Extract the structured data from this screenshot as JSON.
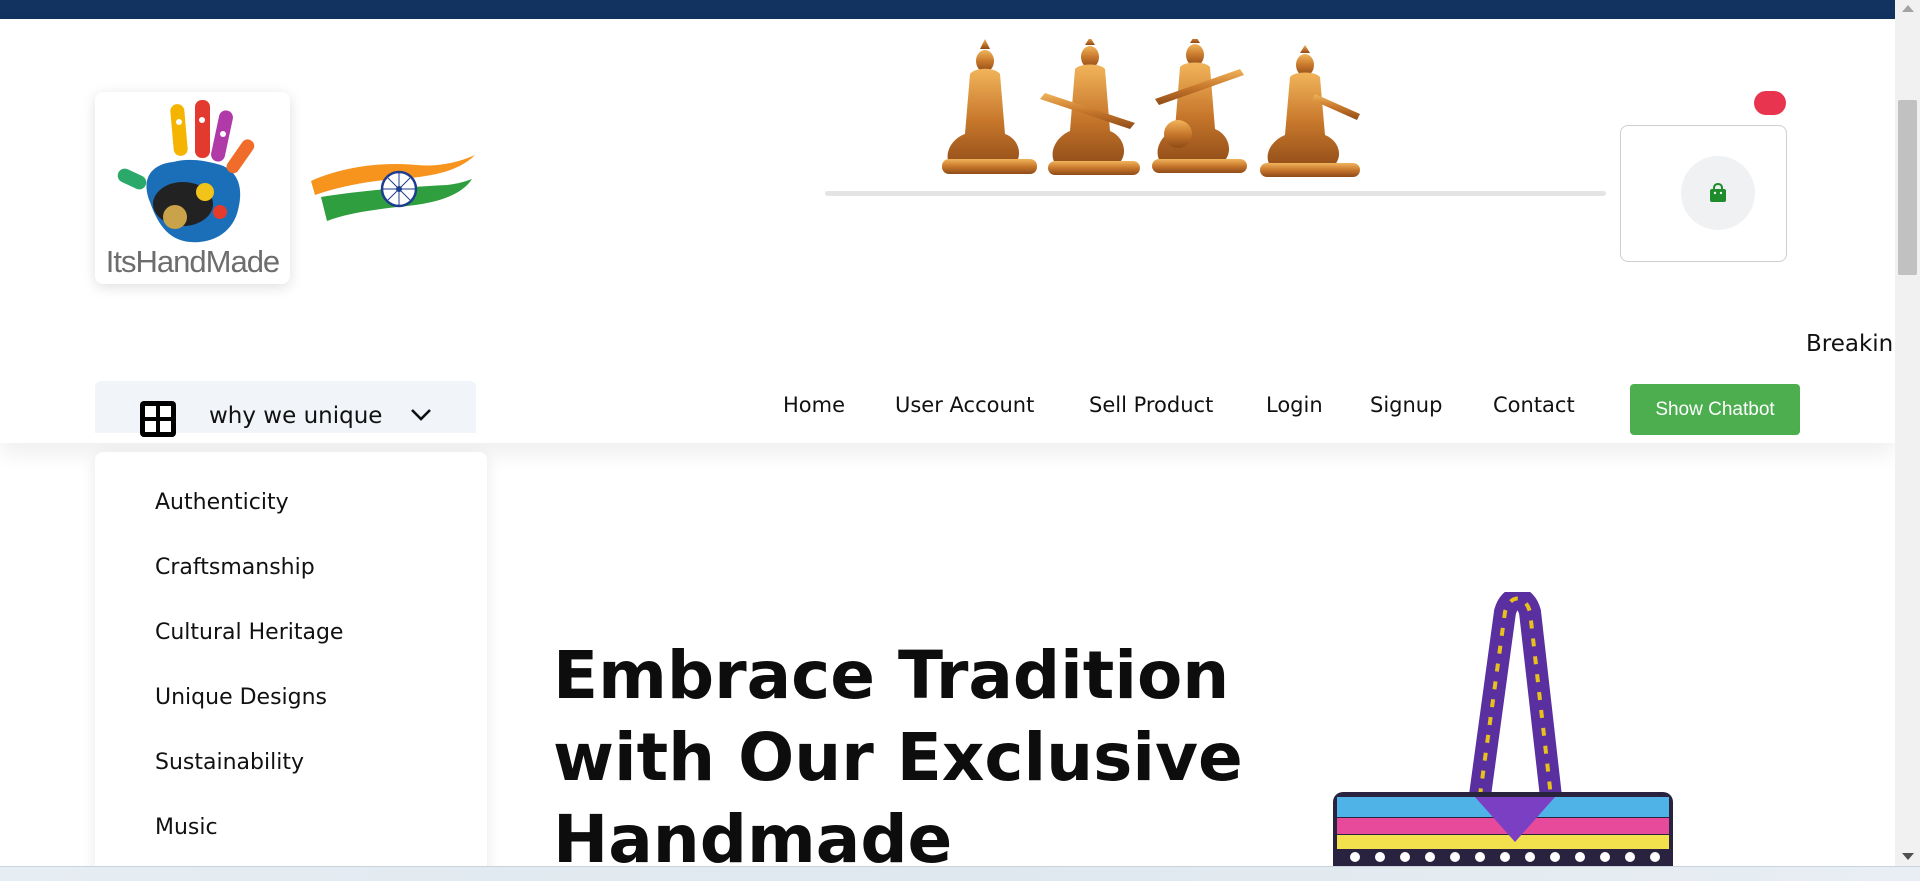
{
  "brand": {
    "logo_text": "ItsHandMade"
  },
  "header": {
    "cart": {
      "icon": "shopping-bag-icon",
      "badge_color": "#e8344f"
    },
    "ticker_text": "Breakin"
  },
  "category_menu": {
    "label": "why we unique",
    "icon": "grid-icon",
    "items": [
      "Authenticity",
      "Craftsmanship",
      "Cultural Heritage",
      "Unique Designs",
      "Sustainability",
      "Music"
    ]
  },
  "nav": {
    "items": [
      "Home",
      "User Account",
      "Sell Product",
      "Login",
      "Signup",
      "Contact"
    ],
    "chatbot_label": "Show Chatbot"
  },
  "hero": {
    "title": "Embrace Tradition with Our Exclusive Handmade"
  },
  "colors": {
    "topbar": "#12325f",
    "chatbot_button": "#4cae4f",
    "badge": "#e8344f",
    "cart_icon": "#1f8c2b"
  }
}
